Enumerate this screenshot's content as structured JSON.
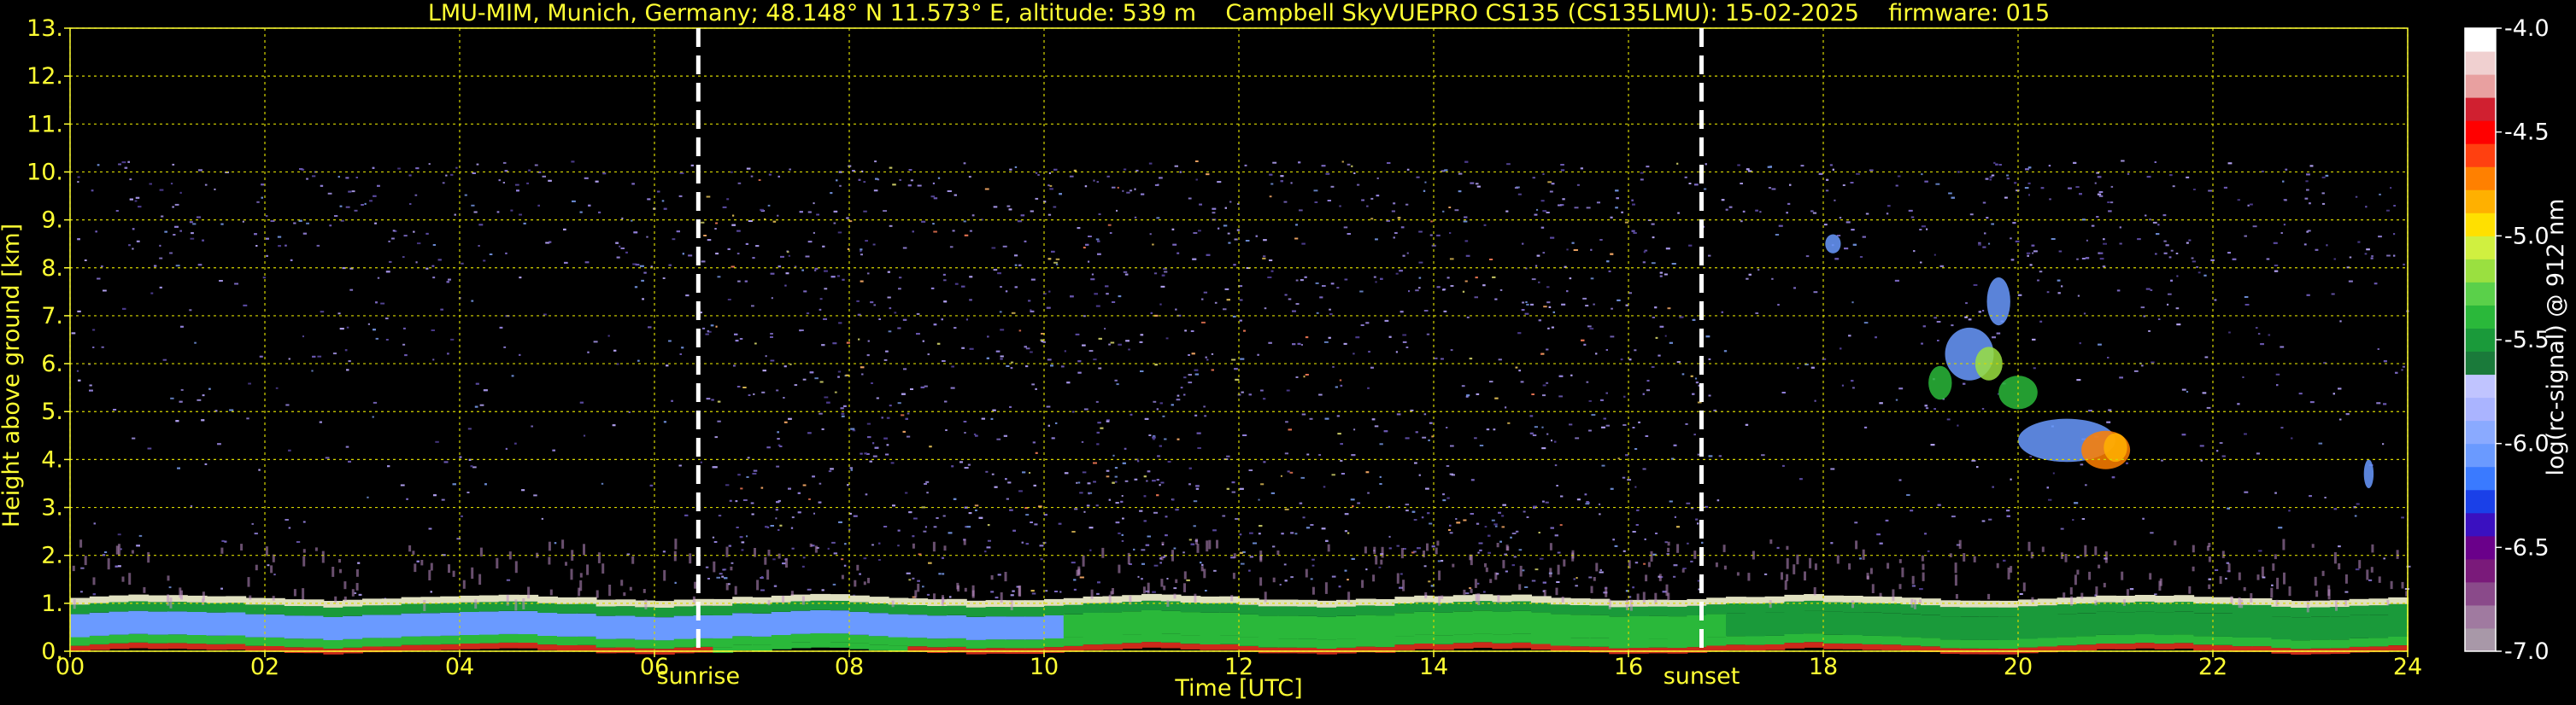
{
  "chart_data": {
    "type": "heatmap",
    "title": "LMU-MIM, Munich, Germany; 48.148° N 11.573° E, altitude: 539 m    Campbell SkyVUEPRO CS135 (CS135LMU): 15-02-2025    firmware: 015",
    "xlabel": "Time [UTC]",
    "ylabel": "Height above ground [km]",
    "xlim": [
      0,
      24
    ],
    "ylim": [
      0,
      13
    ],
    "x_ticks": [
      "00",
      "02",
      "04",
      "06",
      "08",
      "10",
      "12",
      "14",
      "16",
      "18",
      "20",
      "22",
      "24"
    ],
    "y_ticks": [
      "0.",
      "1.",
      "2.",
      "3.",
      "4.",
      "5.",
      "6.",
      "7.",
      "8.",
      "9.",
      "10.",
      "11.",
      "12.",
      "13."
    ],
    "grid": true,
    "markers": [
      {
        "name": "sunrise",
        "x": 6.45
      },
      {
        "name": "sunset",
        "x": 16.75
      }
    ],
    "colorbar": {
      "label": "log(rc-signal) @ 912 nm",
      "range": [
        -7.0,
        -4.0
      ],
      "tick_labels": [
        "-4.0",
        "-4.5",
        "-5.0",
        "-5.5",
        "-6.0",
        "-6.5",
        "-7.0"
      ],
      "tick_values": [
        -4.0,
        -4.5,
        -5.0,
        -5.5,
        -6.0,
        -6.5,
        -7.0
      ],
      "colors": [
        "#a898a8",
        "#a07aa0",
        "#8a4a8a",
        "#7a1a7a",
        "#6a008a",
        "#3a10c0",
        "#1a40e8",
        "#3a7aff",
        "#6a9aff",
        "#8aaaff",
        "#aab4ff",
        "#c0c4ff",
        "#1a7a3a",
        "#1a9a3a",
        "#2ab83a",
        "#5ad04a",
        "#9ae040",
        "#d0f040",
        "#ffe000",
        "#ffb000",
        "#ff8000",
        "#ff4010",
        "#ff0000",
        "#d02030",
        "#e8a0a0",
        "#f0d0d0",
        "#ffffff"
      ]
    },
    "features": [
      {
        "name": "boundary layer",
        "x_start": 0,
        "x_end": 24,
        "height_top": 1.0
      },
      {
        "name": "cloud",
        "x_start": 19.0,
        "x_end": 21.2,
        "height_min": 3.7,
        "height_max": 7.8
      },
      {
        "name": "noise region",
        "x_start": 0,
        "x_end": 24,
        "height_top": 10.25
      }
    ]
  }
}
